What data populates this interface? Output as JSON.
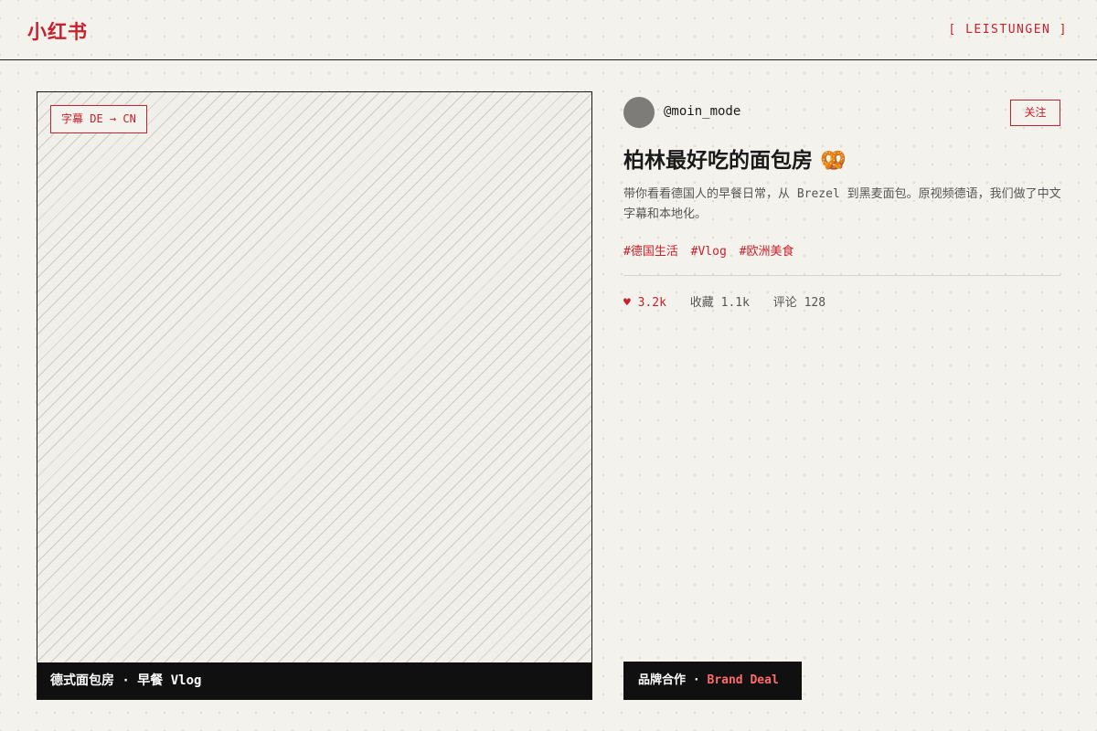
{
  "header": {
    "logo": "小红书",
    "nav_link": "[ LEISTUNGEN ]"
  },
  "video": {
    "subtitle_badge": "字幕 DE → CN",
    "caption": "德式面包房 · 早餐 Vlog"
  },
  "post": {
    "author": "@moin_mode",
    "follow_label": "关注",
    "title": "柏林最好吃的面包房 🥨",
    "description": "带你看看德国人的早餐日常，从 Brezel 到黑麦面包。原视频德语，我们做了中文字幕和本地化。",
    "tags": [
      "#德国生活",
      "#Vlog",
      "#欧洲美食"
    ],
    "stats": {
      "likes": "♥ 3.2k",
      "favorites": "收藏 1.1k",
      "comments": "评论 128"
    }
  },
  "brand_badge": {
    "label_cn": "品牌合作",
    "separator": " · ",
    "label_en": "Brand Deal"
  },
  "colors": {
    "accent": "#c8202c",
    "background": "#f4f2ec",
    "dark": "#101010"
  }
}
